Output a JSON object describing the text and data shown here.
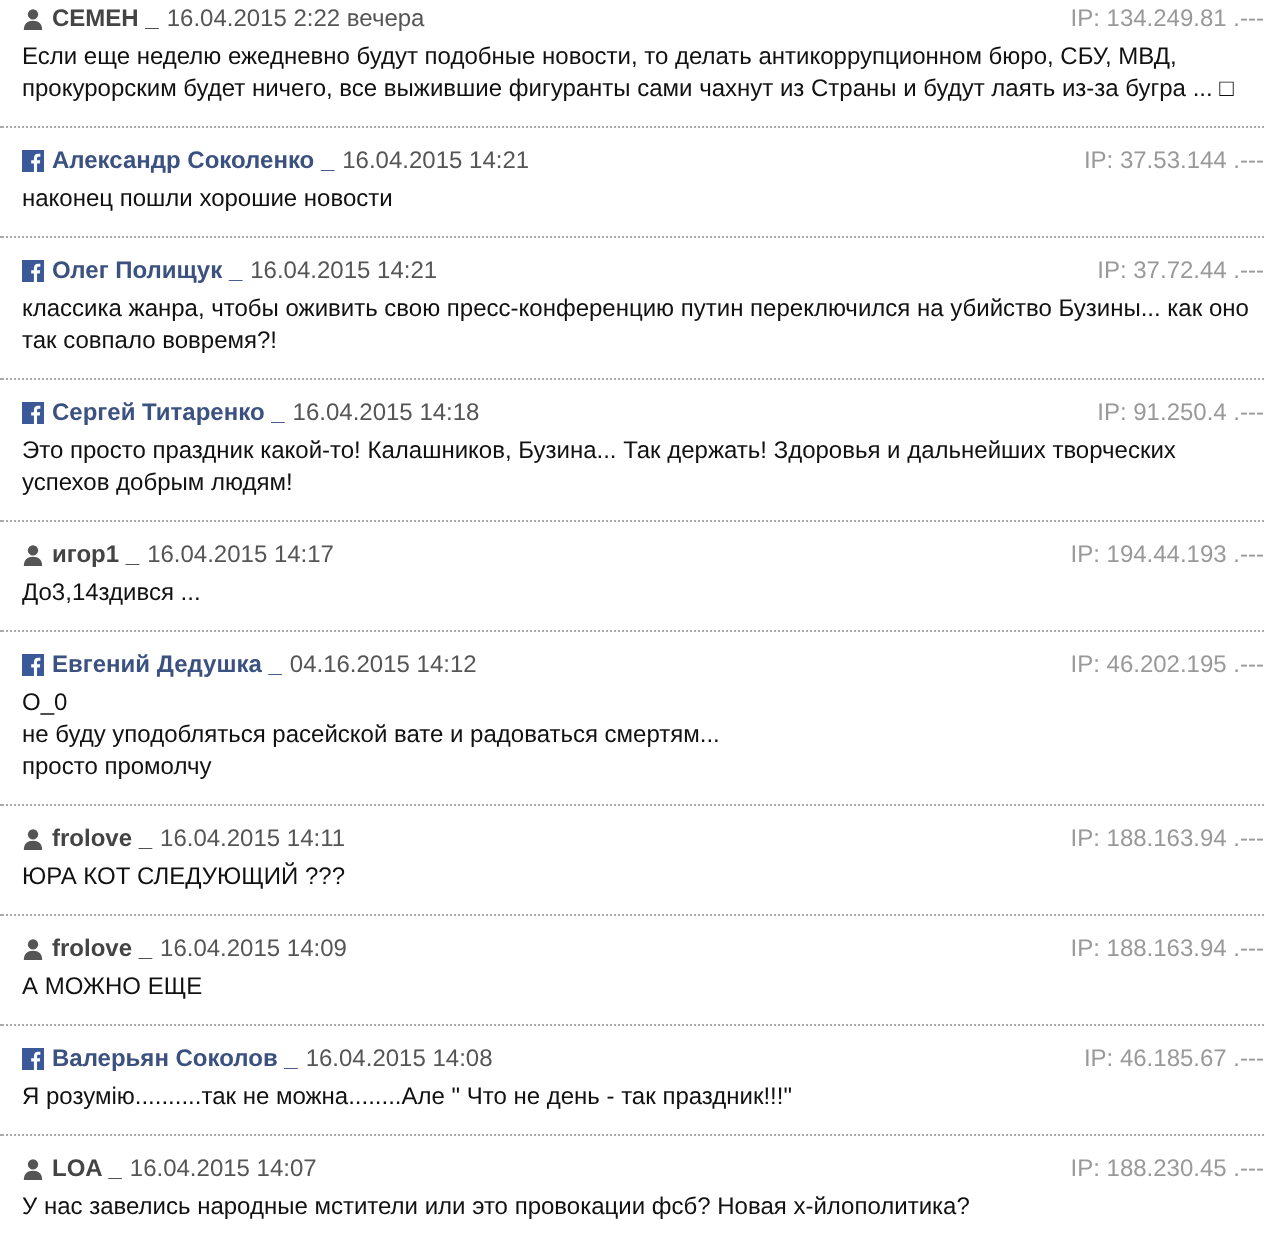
{
  "comments": [
    {
      "kind": "user",
      "author": "СЕМЕН _",
      "date": "16.04.2015 2:22 вечера",
      "ip": "IP: 134.249.81 .---",
      "text": "Если еще неделю ежедневно будут подобные новости, то делать антикоррупционном бюро, СБУ, МВД, прокурорским будет ничего, все выжившие фигуранты сами чахнут из Страны и будут лаять из-за бугра ... □"
    },
    {
      "kind": "facebook",
      "author": "Александр Соколенко _",
      "date": "16.04.2015 14:21",
      "ip": "IP: 37.53.144 .---",
      "text": "наконец пошли хорошие новости"
    },
    {
      "kind": "facebook",
      "author": "Олег Полищук _",
      "date": "16.04.2015 14:21",
      "ip": "IP: 37.72.44 .---",
      "text": "классика жанра, чтобы оживить свою пресс-конференцию путин переключился на убийство Бузины... как оно так совпало вовремя?!"
    },
    {
      "kind": "facebook",
      "author": "Сергей Титаренко _",
      "date": "16.04.2015 14:18",
      "ip": "IP: 91.250.4 .---",
      "text": "Это просто праздник какой-то! Калашников, Бузина... Так держать! Здоровья и дальнейших творческих успехов добрым людям!"
    },
    {
      "kind": "user",
      "author": "игор1 _",
      "date": "16.04.2015 14:17",
      "ip": "IP: 194.44.193 .---",
      "text": "До3,14здився ..."
    },
    {
      "kind": "facebook",
      "author": "Евгений Дедушка _",
      "date": "04.16.2015 14:12",
      "ip": "IP: 46.202.195 .---",
      "text": "O_0\nне буду уподобляться расейской вате и радоваться смертям...\nпросто промолчу"
    },
    {
      "kind": "user",
      "author": "frolove _",
      "date": "16.04.2015 14:11",
      "ip": "IP: 188.163.94 .---",
      "text": "ЮРА КОТ СЛЕДУЮЩИЙ ???"
    },
    {
      "kind": "user",
      "author": "frolove _",
      "date": "16.04.2015 14:09",
      "ip": "IP: 188.163.94 .---",
      "text": "А МОЖНО ЕЩЕ"
    },
    {
      "kind": "facebook",
      "author": "Валерьян Соколов _",
      "date": "16.04.2015 14:08",
      "ip": "IP: 46.185.67 .---",
      "text": "Я розумію..........так не можна........Але \" Что не день - так праздник!!!\""
    },
    {
      "kind": "user",
      "author": "LOA _",
      "date": "16.04.2015 14:07",
      "ip": "IP: 188.230.45 .---",
      "text": "У нас завелись народные мстители или это провокации фсб? Новая х-йлополитика?"
    }
  ]
}
